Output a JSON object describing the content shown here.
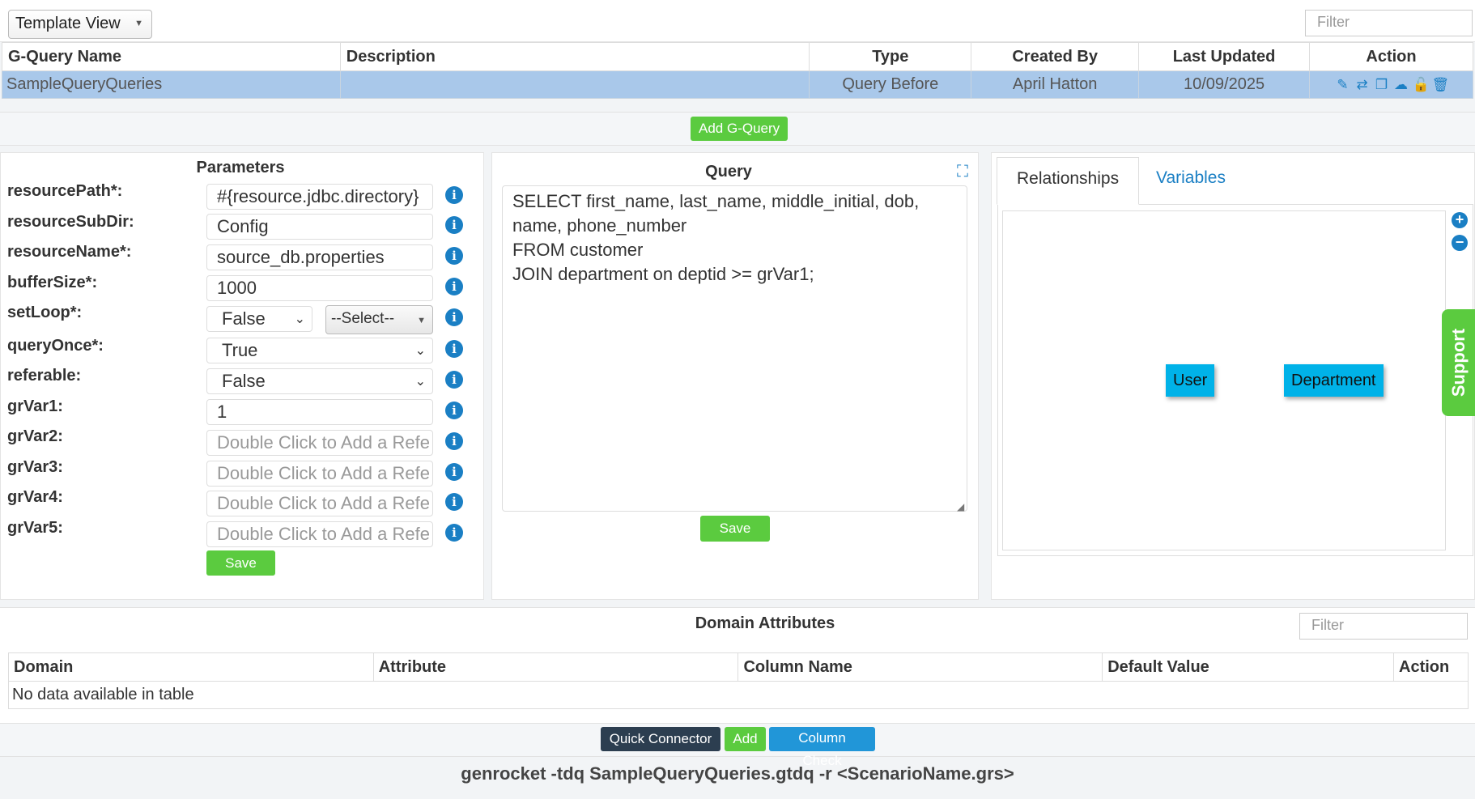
{
  "top": {
    "view_select": "Template View",
    "filter_placeholder": "Filter"
  },
  "gquery_table": {
    "headers": [
      "G-Query Name",
      "Description",
      "Type",
      "Created By",
      "Last Updated",
      "Action"
    ],
    "rows": [
      {
        "name": "SampleQueryQueries",
        "description": "",
        "type": "Query Before",
        "created_by": "April Hatton",
        "last_updated": "10/09/2025"
      }
    ],
    "action_icons": [
      "pencil-icon",
      "swap-icon",
      "copy-icon",
      "cloud-download-icon",
      "unlock-icon",
      "trash-icon"
    ]
  },
  "add_gquery_label": "Add G-Query",
  "parameters": {
    "title": "Parameters",
    "rows": [
      {
        "label": "resourcePath*:",
        "value": "#{resource.jdbc.directory}",
        "kind": "text"
      },
      {
        "label": "resourceSubDir:",
        "value": "Config",
        "kind": "text"
      },
      {
        "label": "resourceName*:",
        "value": "source_db.properties",
        "kind": "text"
      },
      {
        "label": "bufferSize*:",
        "value": "1000",
        "kind": "text"
      },
      {
        "label": "setLoop*:",
        "value": "False",
        "kind": "select-split",
        "extra": "--Select--"
      },
      {
        "label": "queryOnce*:",
        "value": "True",
        "kind": "select"
      },
      {
        "label": "referable:",
        "value": "False",
        "kind": "select"
      },
      {
        "label": "grVar1:",
        "value": "1",
        "kind": "text"
      },
      {
        "label": "grVar2:",
        "value": "",
        "placeholder": "Double Click to Add a Refe",
        "kind": "text"
      },
      {
        "label": "grVar3:",
        "value": "",
        "placeholder": "Double Click to Add a Refe",
        "kind": "text"
      },
      {
        "label": "grVar4:",
        "value": "",
        "placeholder": "Double Click to Add a Refe",
        "kind": "text"
      },
      {
        "label": "grVar5:",
        "value": "",
        "placeholder": "Double Click to Add a Refe",
        "kind": "text"
      }
    ],
    "save_label": "Save"
  },
  "query": {
    "title": "Query",
    "text": "SELECT first_name, last_name, middle_initial, dob,\nname, phone_number\nFROM customer\nJOIN department on deptid >= grVar1;",
    "save_label": "Save"
  },
  "relationships": {
    "tabs": [
      "Relationships",
      "Variables"
    ],
    "nodes": [
      "User",
      "Department"
    ]
  },
  "support_label": "Support",
  "domain_attributes": {
    "title": "Domain Attributes",
    "filter_placeholder": "Filter",
    "headers": [
      "Domain",
      "Attribute",
      "Column Name",
      "Default Value",
      "Action"
    ],
    "empty_text": "No data available in table"
  },
  "bottom_buttons": {
    "quick_connector": "Quick Connector",
    "add": "Add",
    "column_check": "Column Check"
  },
  "command": "genrocket -tdq SampleQueryQueries.gtdq -r <ScenarioName.grs>",
  "colors": {
    "accent_blue": "#1a7fc4",
    "green": "#5bcb3f",
    "row_selected": "#a9c8ea",
    "node_cyan": "#00b2e8",
    "dark": "#2c3e50"
  }
}
